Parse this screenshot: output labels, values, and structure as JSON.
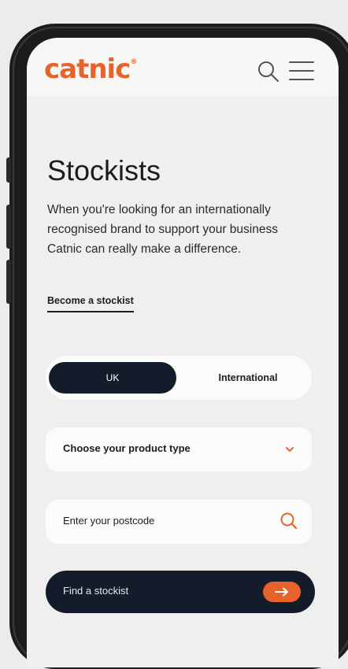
{
  "brand": {
    "logo_text": "catnic",
    "logo_mark": "®",
    "color": "#e8632b"
  },
  "header": {
    "search_icon": "search-icon",
    "menu_icon": "hamburger-menu-icon"
  },
  "main": {
    "title": "Stockists",
    "description": "When you're looking for an internationally recognised brand to support your business Catnic can really make a difference.",
    "become_link": "Become a stockist"
  },
  "region_toggle": {
    "options": [
      "UK",
      "International"
    ],
    "selected": "UK"
  },
  "form": {
    "product_type": {
      "label": "Choose your product type",
      "icon": "chevron-down-icon"
    },
    "postcode": {
      "placeholder": "Enter your postcode",
      "icon": "search-icon"
    },
    "submit": {
      "label": "Find a stockist",
      "icon": "arrow-right-icon"
    }
  },
  "colors": {
    "accent": "#e8632b",
    "dark": "#141c2c",
    "background": "#efefed"
  }
}
